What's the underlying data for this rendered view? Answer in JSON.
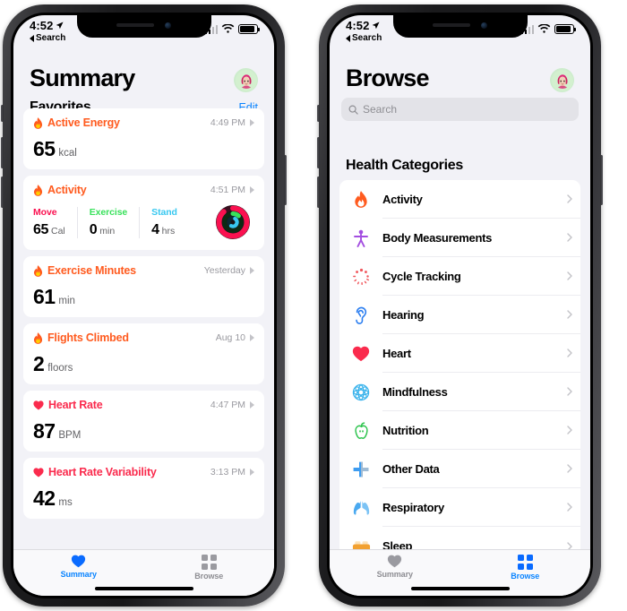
{
  "colors": {
    "accent_blue": "#0a84ff",
    "orange": "#ff5b1f",
    "red": "#fa2b4d",
    "move_pink": "#fa1150",
    "exercise_green": "#39e15b",
    "stand_cyan": "#38c8f0",
    "page_bg": "#f2f2f7",
    "card_bg": "#ffffff",
    "muted_text": "#8e8e93"
  },
  "phones": [
    {
      "id": "summary-phone",
      "statusbar": {
        "time": "4:52",
        "location_icon": "location-arrow-icon",
        "back_label": "Search",
        "signal_icon": "cellular-signal-icon",
        "wifi_icon": "wifi-icon",
        "battery_icon": "battery-icon"
      },
      "header": {
        "title": "Summary",
        "avatar_icon": "memoji-avatar"
      },
      "favorites": {
        "title": "Favorites",
        "edit_label": "Edit"
      },
      "cards": [
        {
          "name": "active-energy",
          "icon": "flame-icon",
          "icon_color": "orange",
          "title": "Active Energy",
          "time": "4:49 PM",
          "value": "65",
          "unit": "kcal"
        },
        {
          "name": "activity",
          "icon": "flame-icon",
          "icon_color": "orange",
          "title": "Activity",
          "time": "4:51 PM",
          "rings_icon": "activity-rings-icon",
          "metrics": [
            {
              "label": "Move",
              "value": "65",
              "unit": "Cal",
              "color": "move"
            },
            {
              "label": "Exercise",
              "value": "0",
              "unit": "min",
              "color": "ex"
            },
            {
              "label": "Stand",
              "value": "4",
              "unit": "hrs",
              "color": "st"
            }
          ]
        },
        {
          "name": "exercise-minutes",
          "icon": "flame-icon",
          "icon_color": "orange",
          "title": "Exercise Minutes",
          "time": "Yesterday",
          "value": "61",
          "unit": "min"
        },
        {
          "name": "flights-climbed",
          "icon": "flame-icon",
          "icon_color": "orange",
          "title": "Flights Climbed",
          "time": "Aug 10",
          "value": "2",
          "unit": "floors"
        },
        {
          "name": "heart-rate",
          "icon": "heart-icon",
          "icon_color": "red",
          "title": "Heart Rate",
          "time": "4:47 PM",
          "value": "87",
          "unit": "BPM"
        },
        {
          "name": "heart-rate-variability",
          "icon": "heart-icon",
          "icon_color": "red",
          "title": "Heart Rate Variability",
          "time": "3:13 PM",
          "value": "42",
          "unit": "ms"
        }
      ],
      "tabs": [
        {
          "label": "Summary",
          "icon": "heart-icon",
          "state": "active"
        },
        {
          "label": "Browse",
          "icon": "grid-icon",
          "state": "inactive"
        }
      ]
    },
    {
      "id": "browse-phone",
      "statusbar": {
        "time": "4:52",
        "location_icon": "location-arrow-icon",
        "back_label": "Search",
        "signal_icon": "cellular-signal-icon",
        "wifi_icon": "wifi-icon",
        "battery_icon": "battery-icon"
      },
      "header": {
        "title": "Browse",
        "avatar_icon": "memoji-avatar"
      },
      "search": {
        "placeholder": "Search",
        "icon": "search-icon"
      },
      "categories_title": "Health Categories",
      "categories": [
        {
          "label": "Activity",
          "icon": "flame-icon",
          "color": "#ff5b1f"
        },
        {
          "label": "Body Measurements",
          "icon": "body-icon",
          "color": "#a34ee0"
        },
        {
          "label": "Cycle Tracking",
          "icon": "cycle-icon",
          "color": "#f0565c"
        },
        {
          "label": "Hearing",
          "icon": "ear-icon",
          "color": "#2b7ef0"
        },
        {
          "label": "Heart",
          "icon": "heart-icon",
          "color": "#fa2b4d"
        },
        {
          "label": "Mindfulness",
          "icon": "mandala-icon",
          "color": "#3cb4ec"
        },
        {
          "label": "Nutrition",
          "icon": "apple-icon",
          "color": "#2ec44e"
        },
        {
          "label": "Other Data",
          "icon": "cross-icon",
          "color": "#3d9cf0"
        },
        {
          "label": "Respiratory",
          "icon": "lungs-icon",
          "color": "#4aa9f0"
        },
        {
          "label": "Sleep",
          "icon": "bed-icon",
          "color": "#f2a131"
        }
      ],
      "tabs": [
        {
          "label": "Summary",
          "icon": "heart-icon",
          "state": "inactive"
        },
        {
          "label": "Browse",
          "icon": "grid-icon",
          "state": "active"
        }
      ]
    }
  ]
}
